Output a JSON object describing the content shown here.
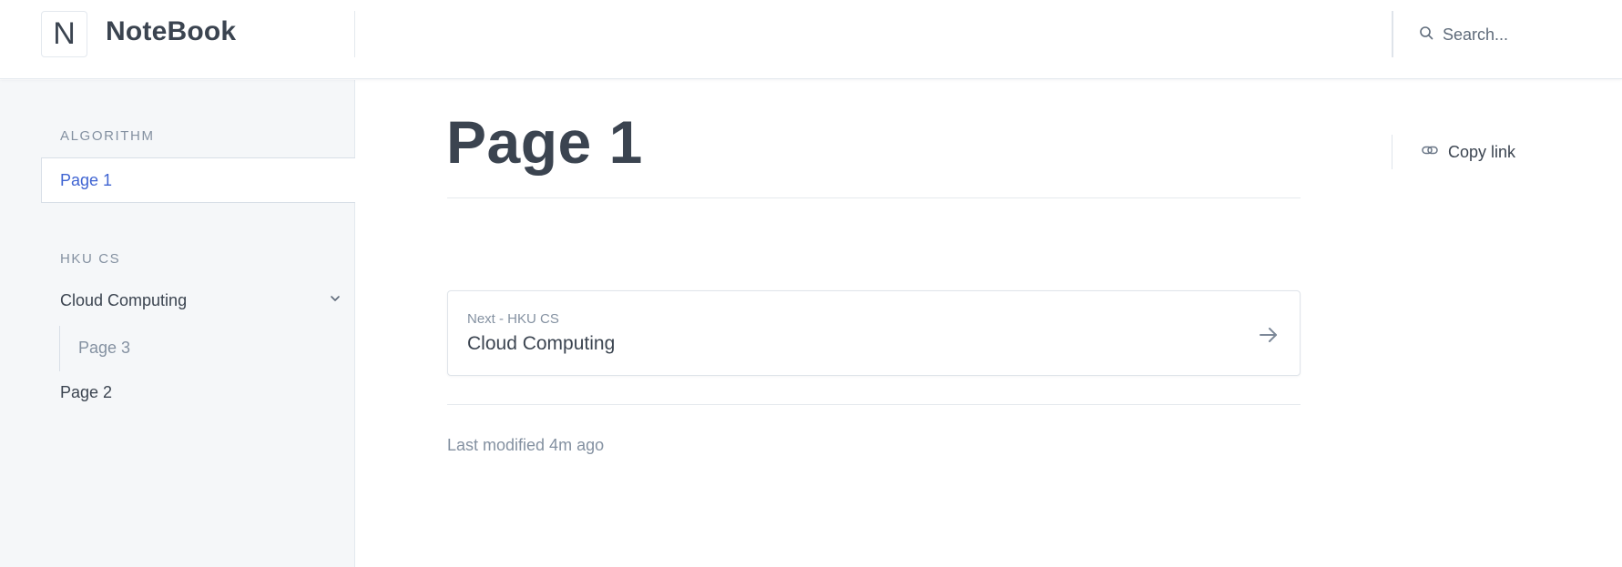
{
  "header": {
    "logo_letter": "N",
    "app_title": "NoteBook",
    "search_placeholder": "Search..."
  },
  "sidebar": {
    "groups": [
      {
        "title": "ALGORITHM",
        "items": [
          {
            "label": "Page 1",
            "active": true
          }
        ]
      },
      {
        "title": "HKU CS",
        "items": [
          {
            "label": "Cloud Computing",
            "expanded": true,
            "children": [
              {
                "label": "Page 3"
              }
            ]
          },
          {
            "label": "Page 2"
          }
        ]
      }
    ]
  },
  "main": {
    "title": "Page 1",
    "copy_link_label": "Copy link",
    "next": {
      "label": "Next - HKU CS",
      "title": "Cloud Computing"
    },
    "last_modified": "Last modified 4m ago"
  },
  "colors": {
    "accent": "#3f64d2",
    "text": "#3b4450",
    "muted": "#8491a1",
    "sidebar_bg": "#f5f7f9",
    "border": "#e3e8ee"
  }
}
